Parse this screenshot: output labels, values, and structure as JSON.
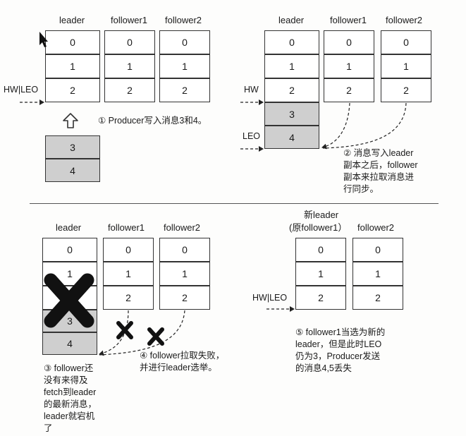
{
  "panel1": {
    "headers": [
      "leader",
      "follower1",
      "follower2"
    ],
    "leader_cells": [
      "0",
      "1",
      "2"
    ],
    "follower1_cells": [
      "0",
      "1",
      "2"
    ],
    "follower2_cells": [
      "0",
      "1",
      "2"
    ],
    "pending_cells": [
      "3",
      "4"
    ],
    "hw_leo": "HW|LEO",
    "note": "① Producer写入消息3和4。"
  },
  "panel2": {
    "headers": [
      "leader",
      "follower1",
      "follower2"
    ],
    "leader_cells": [
      "0",
      "1",
      "2",
      "3",
      "4"
    ],
    "follower1_cells": [
      "0",
      "1",
      "2"
    ],
    "follower2_cells": [
      "0",
      "1",
      "2"
    ],
    "hw": "HW",
    "leo": "LEO",
    "note": "② 消息写入leader\n副本之后，follower\n副本来拉取消息进\n行同步。"
  },
  "panel3": {
    "headers": [
      "leader",
      "follower1",
      "follower2"
    ],
    "leader_cells": [
      "0",
      "1",
      "2",
      "3",
      "4"
    ],
    "follower1_cells": [
      "0",
      "1",
      "2"
    ],
    "follower2_cells": [
      "0",
      "1",
      "2"
    ],
    "note_leader": "③ follower还\n没有来得及\nfetch到leader\n的最新消息，\nleader就宕机\n了",
    "note_fetch": "④ follower拉取失败，\n并进行leader选举。"
  },
  "panel4": {
    "header_new_leader_1": "新leader",
    "header_new_leader_2": "(原follower1）",
    "header_follower2": "follower2",
    "new_leader_cells": [
      "0",
      "1",
      "2"
    ],
    "follower2_cells": [
      "0",
      "1",
      "2"
    ],
    "hw_leo": "HW|LEO",
    "note": "⑤ follower1当选为新的\nleader，但是此时LEO\n仍为3，Producer发送\n的消息4,5丢失"
  }
}
